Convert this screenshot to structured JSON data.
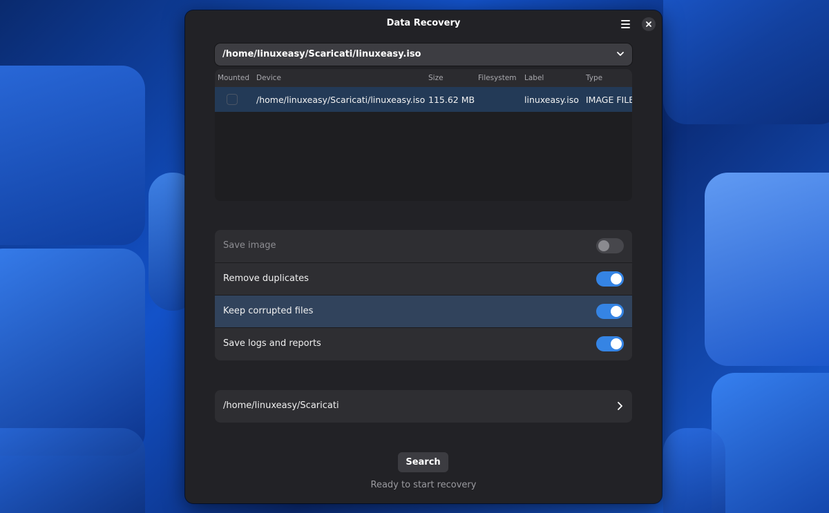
{
  "window": {
    "title": "Data Recovery",
    "menu_icon": "hamburger-menu-icon",
    "close_icon": "close-icon"
  },
  "device_select": {
    "value": "/home/linuxeasy/Scaricati/linuxeasy.iso",
    "icon": "chevron-down-icon"
  },
  "device_table": {
    "columns": [
      "Mounted",
      "Device",
      "Size",
      "Filesystem",
      "Label",
      "Type"
    ],
    "rows": [
      {
        "mounted": false,
        "device": "/home/linuxeasy/Scaricati/linuxeasy.iso",
        "size": "115.62 MB",
        "filesystem": "",
        "label": "linuxeasy.iso",
        "type": "IMAGE FILE"
      }
    ]
  },
  "options": [
    {
      "label": "Save image",
      "enabled": false,
      "sensitive": false
    },
    {
      "label": "Remove duplicates",
      "enabled": true,
      "sensitive": true
    },
    {
      "label": "Keep corrupted files",
      "enabled": true,
      "sensitive": true,
      "highlighted": true
    },
    {
      "label": "Save logs and reports",
      "enabled": true,
      "sensitive": true
    }
  ],
  "destination": {
    "path": "/home/linuxeasy/Scaricati",
    "icon": "chevron-right-icon"
  },
  "actions": {
    "search_label": "Search"
  },
  "status": {
    "text": "Ready to start recovery"
  },
  "colors": {
    "accent": "#3584e4",
    "window_bg": "#222226",
    "selected_row": "#233a57"
  }
}
